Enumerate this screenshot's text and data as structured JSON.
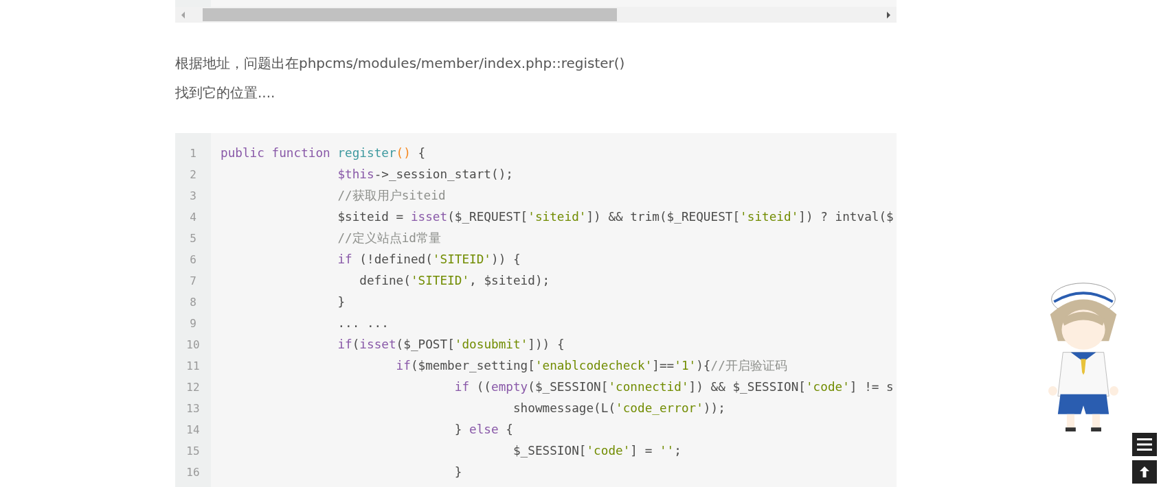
{
  "paragraphs": [
    "根据地址，问题出在phpcms/modules/member/index.php::register()",
    "找到它的位置...."
  ],
  "code": {
    "lines": [
      {
        "number": "1",
        "tokens": [
          {
            "kind": "keyword",
            "text": "public function "
          },
          {
            "kind": "function",
            "text": "register"
          },
          {
            "kind": "paren",
            "text": "()"
          },
          {
            "kind": "plain",
            "text": " {"
          }
        ]
      },
      {
        "number": "2",
        "tokens": [
          {
            "kind": "keyword",
            "text": "                $this"
          },
          {
            "kind": "plain",
            "text": "->_session_start();"
          }
        ]
      },
      {
        "number": "3",
        "tokens": [
          {
            "kind": "comment",
            "text": "                //获取用户siteid"
          }
        ]
      },
      {
        "number": "4",
        "tokens": [
          {
            "kind": "plain",
            "text": "                $siteid = "
          },
          {
            "kind": "keyword",
            "text": "isset"
          },
          {
            "kind": "plain",
            "text": "($_REQUEST["
          },
          {
            "kind": "string",
            "text": "'siteid'"
          },
          {
            "kind": "plain",
            "text": "]) && trim($_REQUEST["
          },
          {
            "kind": "string",
            "text": "'siteid'"
          },
          {
            "kind": "plain",
            "text": "]) ? intval($"
          }
        ]
      },
      {
        "number": "5",
        "tokens": [
          {
            "kind": "comment",
            "text": "                //定义站点id常量"
          }
        ]
      },
      {
        "number": "6",
        "tokens": [
          {
            "kind": "keyword",
            "text": "                if"
          },
          {
            "kind": "plain",
            "text": " (!defined("
          },
          {
            "kind": "string",
            "text": "'SITEID'"
          },
          {
            "kind": "plain",
            "text": ")) {"
          }
        ]
      },
      {
        "number": "7",
        "tokens": [
          {
            "kind": "plain",
            "text": "                   define("
          },
          {
            "kind": "string",
            "text": "'SITEID'"
          },
          {
            "kind": "plain",
            "text": ", $siteid);"
          }
        ]
      },
      {
        "number": "8",
        "tokens": [
          {
            "kind": "plain",
            "text": "                }"
          }
        ]
      },
      {
        "number": "9",
        "tokens": [
          {
            "kind": "plain",
            "text": "                ... ..."
          }
        ]
      },
      {
        "number": "10",
        "tokens": [
          {
            "kind": "keyword",
            "text": "                if"
          },
          {
            "kind": "plain",
            "text": "("
          },
          {
            "kind": "keyword",
            "text": "isset"
          },
          {
            "kind": "plain",
            "text": "($_POST["
          },
          {
            "kind": "string",
            "text": "'dosubmit'"
          },
          {
            "kind": "plain",
            "text": "])) {"
          }
        ]
      },
      {
        "number": "11",
        "tokens": [
          {
            "kind": "keyword",
            "text": "                        if"
          },
          {
            "kind": "plain",
            "text": "($member_setting["
          },
          {
            "kind": "string",
            "text": "'enablcodecheck'"
          },
          {
            "kind": "plain",
            "text": "]=="
          },
          {
            "kind": "string",
            "text": "'1'"
          },
          {
            "kind": "plain",
            "text": "){"
          },
          {
            "kind": "comment",
            "text": "//开启验证码"
          }
        ]
      },
      {
        "number": "12",
        "tokens": [
          {
            "kind": "keyword",
            "text": "                                if"
          },
          {
            "kind": "plain",
            "text": " (("
          },
          {
            "kind": "keyword",
            "text": "empty"
          },
          {
            "kind": "plain",
            "text": "($_SESSION["
          },
          {
            "kind": "string",
            "text": "'connectid'"
          },
          {
            "kind": "plain",
            "text": "]) && $_SESSION["
          },
          {
            "kind": "string",
            "text": "'code'"
          },
          {
            "kind": "plain",
            "text": "] != s"
          }
        ]
      },
      {
        "number": "13",
        "tokens": [
          {
            "kind": "plain",
            "text": "                                        showmessage(L("
          },
          {
            "kind": "string",
            "text": "'code_error'"
          },
          {
            "kind": "plain",
            "text": "));"
          }
        ]
      },
      {
        "number": "14",
        "tokens": [
          {
            "kind": "plain",
            "text": "                                } "
          },
          {
            "kind": "keyword",
            "text": "else"
          },
          {
            "kind": "plain",
            "text": " {"
          }
        ]
      },
      {
        "number": "15",
        "tokens": [
          {
            "kind": "plain",
            "text": "                                        $_SESSION["
          },
          {
            "kind": "string",
            "text": "'code'"
          },
          {
            "kind": "plain",
            "text": "] = "
          },
          {
            "kind": "string",
            "text": "''"
          },
          {
            "kind": "plain",
            "text": ";"
          }
        ]
      },
      {
        "number": "16",
        "tokens": [
          {
            "kind": "plain",
            "text": "                                }"
          }
        ]
      }
    ]
  },
  "floating_buttons": [
    {
      "kind": "menu"
    },
    {
      "kind": "top"
    }
  ]
}
